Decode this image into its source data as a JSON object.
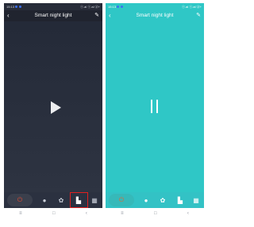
{
  "status_bar": {
    "time": "15:13",
    "indicators": "ⓥ.al ⓥ.al ⓓ+"
  },
  "header": {
    "title": "Smart night light",
    "back_icon": "chevron-left-icon",
    "edit_icon": "pencil-icon"
  },
  "left_screen": {
    "state": "paused",
    "center_control": "play-icon"
  },
  "right_screen": {
    "state": "playing",
    "center_control": "pause-icon",
    "background": "#2fc7c6"
  },
  "toolbar": {
    "items": [
      {
        "name": "power",
        "glyph": "⏻"
      },
      {
        "name": "bulb",
        "glyph": "●"
      },
      {
        "name": "palette",
        "glyph": "✿"
      },
      {
        "name": "music",
        "glyph": "▙"
      },
      {
        "name": "grid",
        "glyph": "▦"
      }
    ],
    "highlighted": "music"
  },
  "navbar": {
    "items": [
      "≡",
      "□",
      "‹"
    ]
  }
}
